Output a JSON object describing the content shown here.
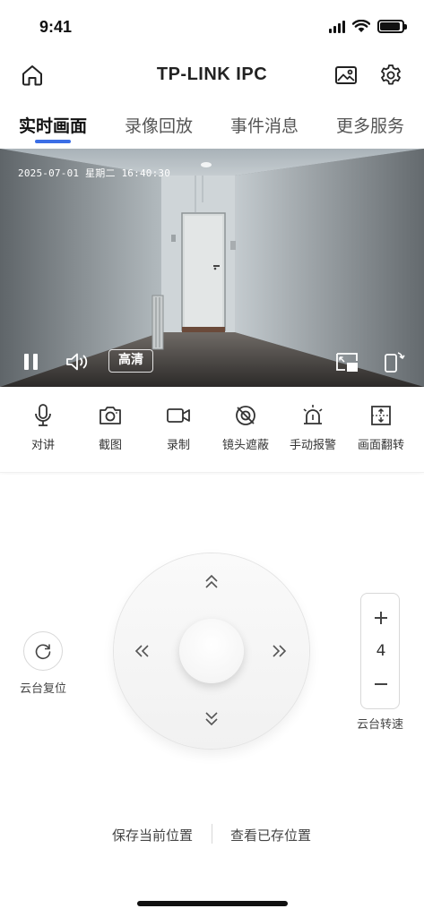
{
  "status_bar": {
    "time": "9:41",
    "battery_level": 0.9
  },
  "nav": {
    "title": "TP-LINK IPC",
    "left_icon": "home-icon",
    "right_icons": [
      "gallery-icon",
      "settings-icon"
    ]
  },
  "tabs": [
    {
      "label": "实时画面",
      "active": true
    },
    {
      "label": "录像回放",
      "active": false
    },
    {
      "label": "事件消息",
      "active": false
    },
    {
      "label": "更多服务",
      "active": false
    }
  ],
  "video": {
    "timestamp": "2025-07-01 星期二 16:40:30",
    "quality_label": "高清",
    "controls": [
      "pause-icon",
      "volume-icon",
      "pip-icon",
      "rotate-screen-icon"
    ]
  },
  "toolbar": [
    {
      "label": "对讲",
      "icon": "microphone-icon"
    },
    {
      "label": "截图",
      "icon": "camera-icon"
    },
    {
      "label": "录制",
      "icon": "video-record-icon"
    },
    {
      "label": "镜头遮蔽",
      "icon": "lens-mask-icon"
    },
    {
      "label": "手动报警",
      "icon": "alarm-icon"
    },
    {
      "label": "画面翻转",
      "icon": "flip-icon"
    }
  ],
  "ptz": {
    "reset_label": "云台复位",
    "speed_value": "4",
    "speed_label": "云台转速"
  },
  "positions": {
    "save_label": "保存当前位置",
    "view_label": "查看已存位置"
  },
  "colors": {
    "accent": "#3b6ee6",
    "text": "#222222"
  }
}
